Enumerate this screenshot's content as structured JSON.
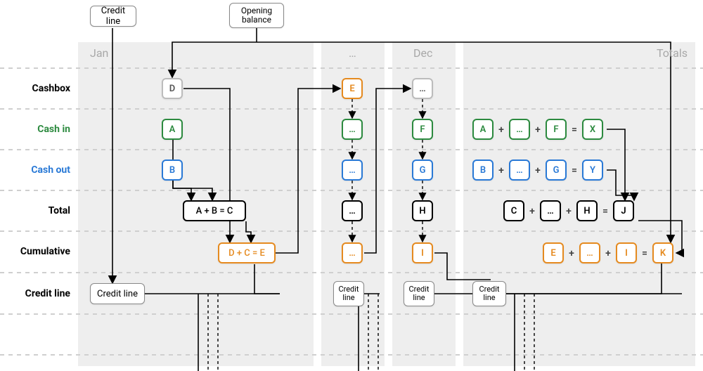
{
  "header": {
    "credit_line": "Credit line",
    "opening_balance": "Opening\nbalance"
  },
  "row_labels": {
    "cashbox": "Cashbox",
    "cash_in": "Cash in",
    "cash_out": "Cash out",
    "total": "Total",
    "cumulative": "Cumulative",
    "credit_line": "Credit line"
  },
  "columns": {
    "jan": "Jan",
    "mid": "…",
    "dec": "Dec",
    "totals": "Totals"
  },
  "cells": {
    "jan": {
      "cashbox": "D",
      "cash_in": "A",
      "cash_out": "B",
      "total": "A + B = C",
      "cumulative": "D + C = E",
      "credit": "Credit line"
    },
    "mid": {
      "cashbox": "E",
      "cash_in": "…",
      "cash_out": "…",
      "total": "…",
      "cumulative": "…",
      "credit": "Credit\nline"
    },
    "dec": {
      "cashbox": "…",
      "cash_in": "F",
      "cash_out": "G",
      "total": "H",
      "cumulative": "I",
      "credit": "Credit\nline"
    },
    "totals": {
      "cash_in": {
        "a": "A",
        "b": "…",
        "c": "F",
        "r": "X"
      },
      "cash_out": {
        "a": "B",
        "b": "…",
        "c": "G",
        "r": "Y"
      },
      "total": {
        "a": "C",
        "b": "…",
        "c": "H",
        "r": "J"
      },
      "cumulative": {
        "a": "E",
        "b": "…",
        "c": "I",
        "r": "K"
      },
      "credit": "Credit\nline"
    }
  },
  "ops": {
    "plus": "+",
    "eq": "="
  },
  "colors": {
    "gray_bg": "#eeeeee",
    "green": "#2c8a3f",
    "blue": "#2979d6",
    "orange": "#e58a1f",
    "black": "#000000",
    "label_gray": "#a8a8a8",
    "dash": "#cfcfcf"
  }
}
